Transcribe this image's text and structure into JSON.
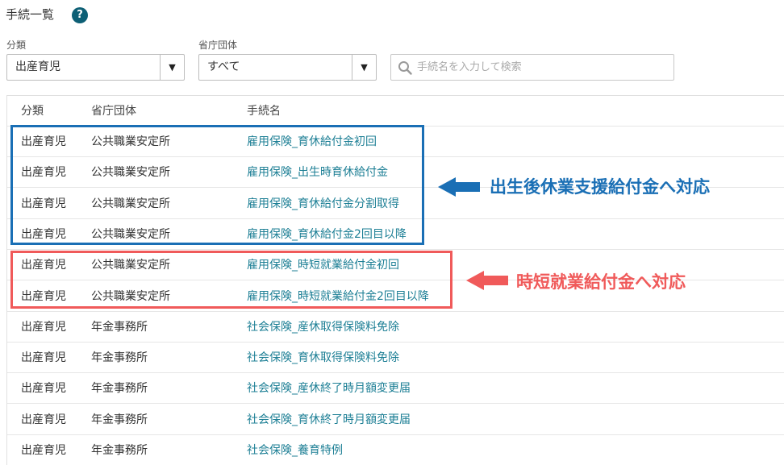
{
  "page": {
    "title": "手続一覧",
    "help_glyph": "?"
  },
  "filters": {
    "category_label": "分類",
    "category_value": "出産育児",
    "agency_label": "省庁団体",
    "agency_value": "すべて",
    "caret_glyph": "▼",
    "search_placeholder": "手続名を入力して検索"
  },
  "table": {
    "headers": [
      "分類",
      "省庁団体",
      "手続名"
    ],
    "rows": [
      [
        "出産育児",
        "公共職業安定所",
        "雇用保険_育休給付金初回"
      ],
      [
        "出産育児",
        "公共職業安定所",
        "雇用保険_出生時育休給付金"
      ],
      [
        "出産育児",
        "公共職業安定所",
        "雇用保険_育休給付金分割取得"
      ],
      [
        "出産育児",
        "公共職業安定所",
        "雇用保険_育休給付金2回目以降"
      ],
      [
        "出産育児",
        "公共職業安定所",
        "雇用保険_時短就業給付金初回"
      ],
      [
        "出産育児",
        "公共職業安定所",
        "雇用保険_時短就業給付金2回目以降"
      ],
      [
        "出産育児",
        "年金事務所",
        "社会保険_産休取得保険料免除"
      ],
      [
        "出産育児",
        "年金事務所",
        "社会保険_育休取得保険料免除"
      ],
      [
        "出産育児",
        "年金事務所",
        "社会保険_産休終了時月額変更届"
      ],
      [
        "出産育児",
        "年金事務所",
        "社会保険_育休終了時月額変更届"
      ],
      [
        "出産育児",
        "年金事務所",
        "社会保険_養育特例"
      ]
    ]
  },
  "annotations": {
    "blue_note": "出生後休業支援給付金へ対応",
    "red_note": "時短就業給付金へ対応",
    "blue_color": "#1a6fb5",
    "red_color": "#f05a5a"
  },
  "colors": {
    "link": "#1d7f95",
    "help_icon_bg": "#0d5f75"
  }
}
